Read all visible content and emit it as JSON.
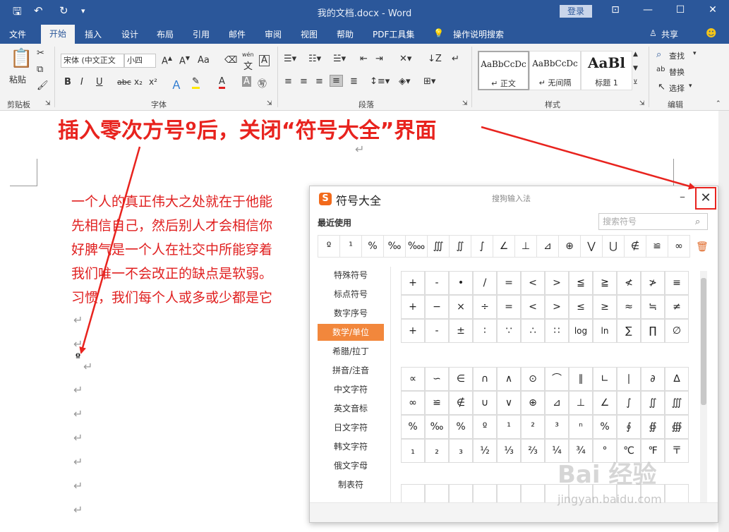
{
  "titlebar": {
    "doc_title": "我的文档.docx  -  Word",
    "login": "登录",
    "save_icon": "save-icon",
    "undo_icon": "undo-icon",
    "redo_icon": "redo-icon"
  },
  "tabs": [
    "文件",
    "开始",
    "插入",
    "设计",
    "布局",
    "引用",
    "邮件",
    "审阅",
    "视图",
    "帮助",
    "PDF工具集",
    "操作说明搜索"
  ],
  "share": "共享",
  "ribbon": {
    "clipboard": {
      "paste": "粘贴",
      "label": "剪贴板"
    },
    "font": {
      "name": "宋体 (中文正文",
      "size": "小四",
      "label": "字体",
      "aa": "Aa",
      "bold": "B",
      "italic": "I",
      "underline": "U",
      "strike": "abc",
      "sub": "x₂",
      "sup": "x²",
      "wen": "wén",
      "wen_char": "文",
      "a_char": "A"
    },
    "paragraph": {
      "label": "段落"
    },
    "styles": {
      "label": "样式",
      "items": [
        {
          "sample": "AaBbCcDc",
          "name": "↵ 正文"
        },
        {
          "sample": "AaBbCcDc",
          "name": "↵ 无间隔"
        },
        {
          "sample": "AaBl",
          "name": "标题 1"
        }
      ]
    },
    "editing": {
      "find": "查找",
      "replace": "替换",
      "select": "选择",
      "label": "编辑"
    }
  },
  "annotation": "插入零次方号º后，关闭“符号大全”界面",
  "document": {
    "pilcrow": "↵",
    "lines": [
      "一个人的真正伟大之处就在于他能",
      "先相信自己，然后别人才会相信你",
      "好脾气是一个人在社交中所能穿着",
      "我们唯一不会改正的缺点是软弱。",
      "习惯，我们每个人或多或少都是它"
    ],
    "inserted": "º"
  },
  "panel": {
    "title": "符号大全",
    "ime": "搜狗输入法",
    "minimize": "–",
    "close": "✕",
    "recent_label": "最近使用",
    "search_placeholder": "搜索符号",
    "recent": [
      "º",
      "¹",
      "%",
      "‰",
      "‱",
      "∭",
      "∬",
      "∫",
      "∠",
      "⊥",
      "⊿",
      "⊕",
      "⋁",
      "⋃",
      "∉",
      "≌",
      "∞"
    ],
    "categories": [
      "特殊符号",
      "标点符号",
      "数字序号",
      "数学/单位",
      "希腊/拉丁",
      "拼音/注音",
      "中文字符",
      "英文音标",
      "日文字符",
      "韩文字符",
      "俄文字母",
      "制表符"
    ],
    "active_category": "数学/单位",
    "grid1": [
      [
        "+",
        "-",
        "•",
        "/",
        "=",
        "<",
        ">",
        "≦",
        "≧",
        "≮",
        "≯",
        "≡"
      ],
      [
        "+",
        "−",
        "×",
        "÷",
        "=",
        "<",
        ">",
        "≤",
        "≥",
        "≈",
        "≒",
        "≠"
      ],
      [
        "+",
        "-",
        "±",
        "∶",
        "∵",
        "∴",
        "∷",
        "log",
        "ln",
        "∑",
        "∏",
        "∅"
      ]
    ],
    "grid2": [
      [
        "∝",
        "∽",
        "∈",
        "∩",
        "∧",
        "⊙",
        "⌒",
        "∥",
        "∟",
        "∣",
        "∂",
        "∆"
      ],
      [
        "∞",
        "≌",
        "∉",
        "∪",
        "∨",
        "⊕",
        "⊿",
        "⊥",
        "∠",
        "∫",
        "∬",
        "∭"
      ],
      [
        "%",
        "‰",
        "%",
        "º",
        "¹",
        "²",
        "³",
        "ⁿ",
        "%",
        "∮",
        "∯",
        "∰"
      ],
      [
        "₁",
        "₂",
        "₃",
        "½",
        "⅓",
        "⅔",
        "¼",
        "¾",
        "°",
        "℃",
        "℉",
        "〒"
      ]
    ]
  },
  "watermark": {
    "main": "Bai  经验",
    "sub": "jingyan.baidu.com"
  }
}
